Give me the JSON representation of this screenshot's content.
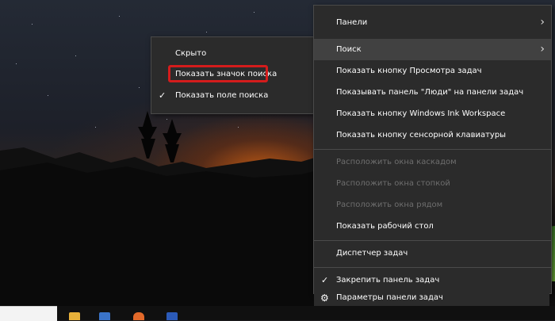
{
  "submenu": {
    "items": [
      {
        "label": "Скрыто",
        "checked": false
      },
      {
        "label": "Показать значок поиска",
        "checked": false,
        "highlighted": true
      },
      {
        "label": "Показать поле поиска",
        "checked": true
      }
    ]
  },
  "context_menu": {
    "panels": "Панели",
    "search": "Поиск",
    "show_task_view": "Показать кнопку Просмотра задач",
    "show_people": "Показывать панель \"Люди\" на панели задач",
    "show_ink": "Показать кнопку Windows Ink Workspace",
    "show_keyboard": "Показать кнопку сенсорной клавиатуры",
    "cascade": "Расположить окна каскадом",
    "stacked": "Расположить окна стопкой",
    "side_by_side": "Расположить окна рядом",
    "show_desktop": "Показать рабочий стол",
    "task_manager": "Диспетчер задач",
    "lock_taskbar": "Закрепить панель задач",
    "taskbar_settings": "Параметры панели задач"
  },
  "icons": {
    "check": "✓",
    "chevron": "›",
    "gear": "⚙"
  },
  "colors": {
    "menu_bg": "#2b2b2b",
    "hover": "#414141",
    "disabled_text": "#6e6e6e",
    "highlight_border": "#d41c1c"
  }
}
